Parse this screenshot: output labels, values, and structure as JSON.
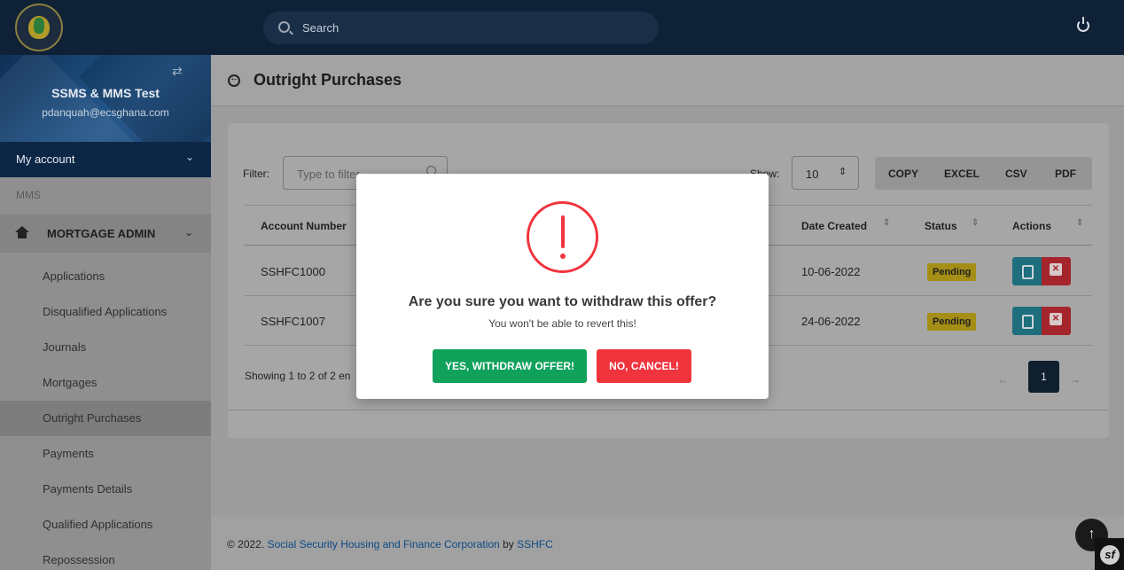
{
  "topbar": {
    "search_placeholder": "Search",
    "logo_icon": "ssnit-logo-icon",
    "power_icon": "power-icon"
  },
  "sidebar": {
    "app_name": "SSMS & MMS Test",
    "email": "pdanquah@ecsghana.com",
    "my_account": "My account",
    "section_label": "MMS",
    "group_label": "MORTGAGE ADMIN",
    "items": [
      {
        "label": "Applications"
      },
      {
        "label": "Disqualified Applications"
      },
      {
        "label": "Journals"
      },
      {
        "label": "Mortgages"
      },
      {
        "label": "Outright Purchases"
      },
      {
        "label": "Payments"
      },
      {
        "label": "Payments Details"
      },
      {
        "label": "Qualified Applications"
      },
      {
        "label": "Repossession"
      }
    ],
    "active_item": "Outright Purchases"
  },
  "page": {
    "title": "Outright Purchases"
  },
  "table_controls": {
    "filter_label": "Filter:",
    "filter_placeholder": "Type to filter...",
    "show_label": "Show:",
    "show_value": "10",
    "exports": [
      "COPY",
      "EXCEL",
      "CSV",
      "PDF"
    ]
  },
  "table": {
    "columns": [
      "Account Number",
      "Date Created",
      "Status",
      "Actions"
    ],
    "rows": [
      {
        "account": "SSHFC1000",
        "date": "10-06-2022",
        "status": "Pending"
      },
      {
        "account": "SSHFC1007",
        "date": "24-06-2022",
        "status": "Pending"
      }
    ],
    "showing_text": "Showing 1 to 2 of 2 en",
    "pager": {
      "prev": "←",
      "page": "1",
      "next": "→"
    }
  },
  "footer": {
    "prefix": "© 2022.",
    "org_link": "Social Security Housing and Finance Corporation",
    "by": "by",
    "short_link": "SSHFC"
  },
  "modal": {
    "title": "Are you sure you want to withdraw this offer?",
    "text": "You won't be able to revert this!",
    "confirm_label": "YES, WITHDRAW OFFER!",
    "cancel_label": "NO, CANCEL!"
  },
  "colors": {
    "navbar": "#0f2136",
    "confirm": "#10a15b",
    "cancel": "#f0343e",
    "pending_badge": "#a58e16",
    "edit_button": "#1e6e7d",
    "delete_button": "#a5252c"
  }
}
